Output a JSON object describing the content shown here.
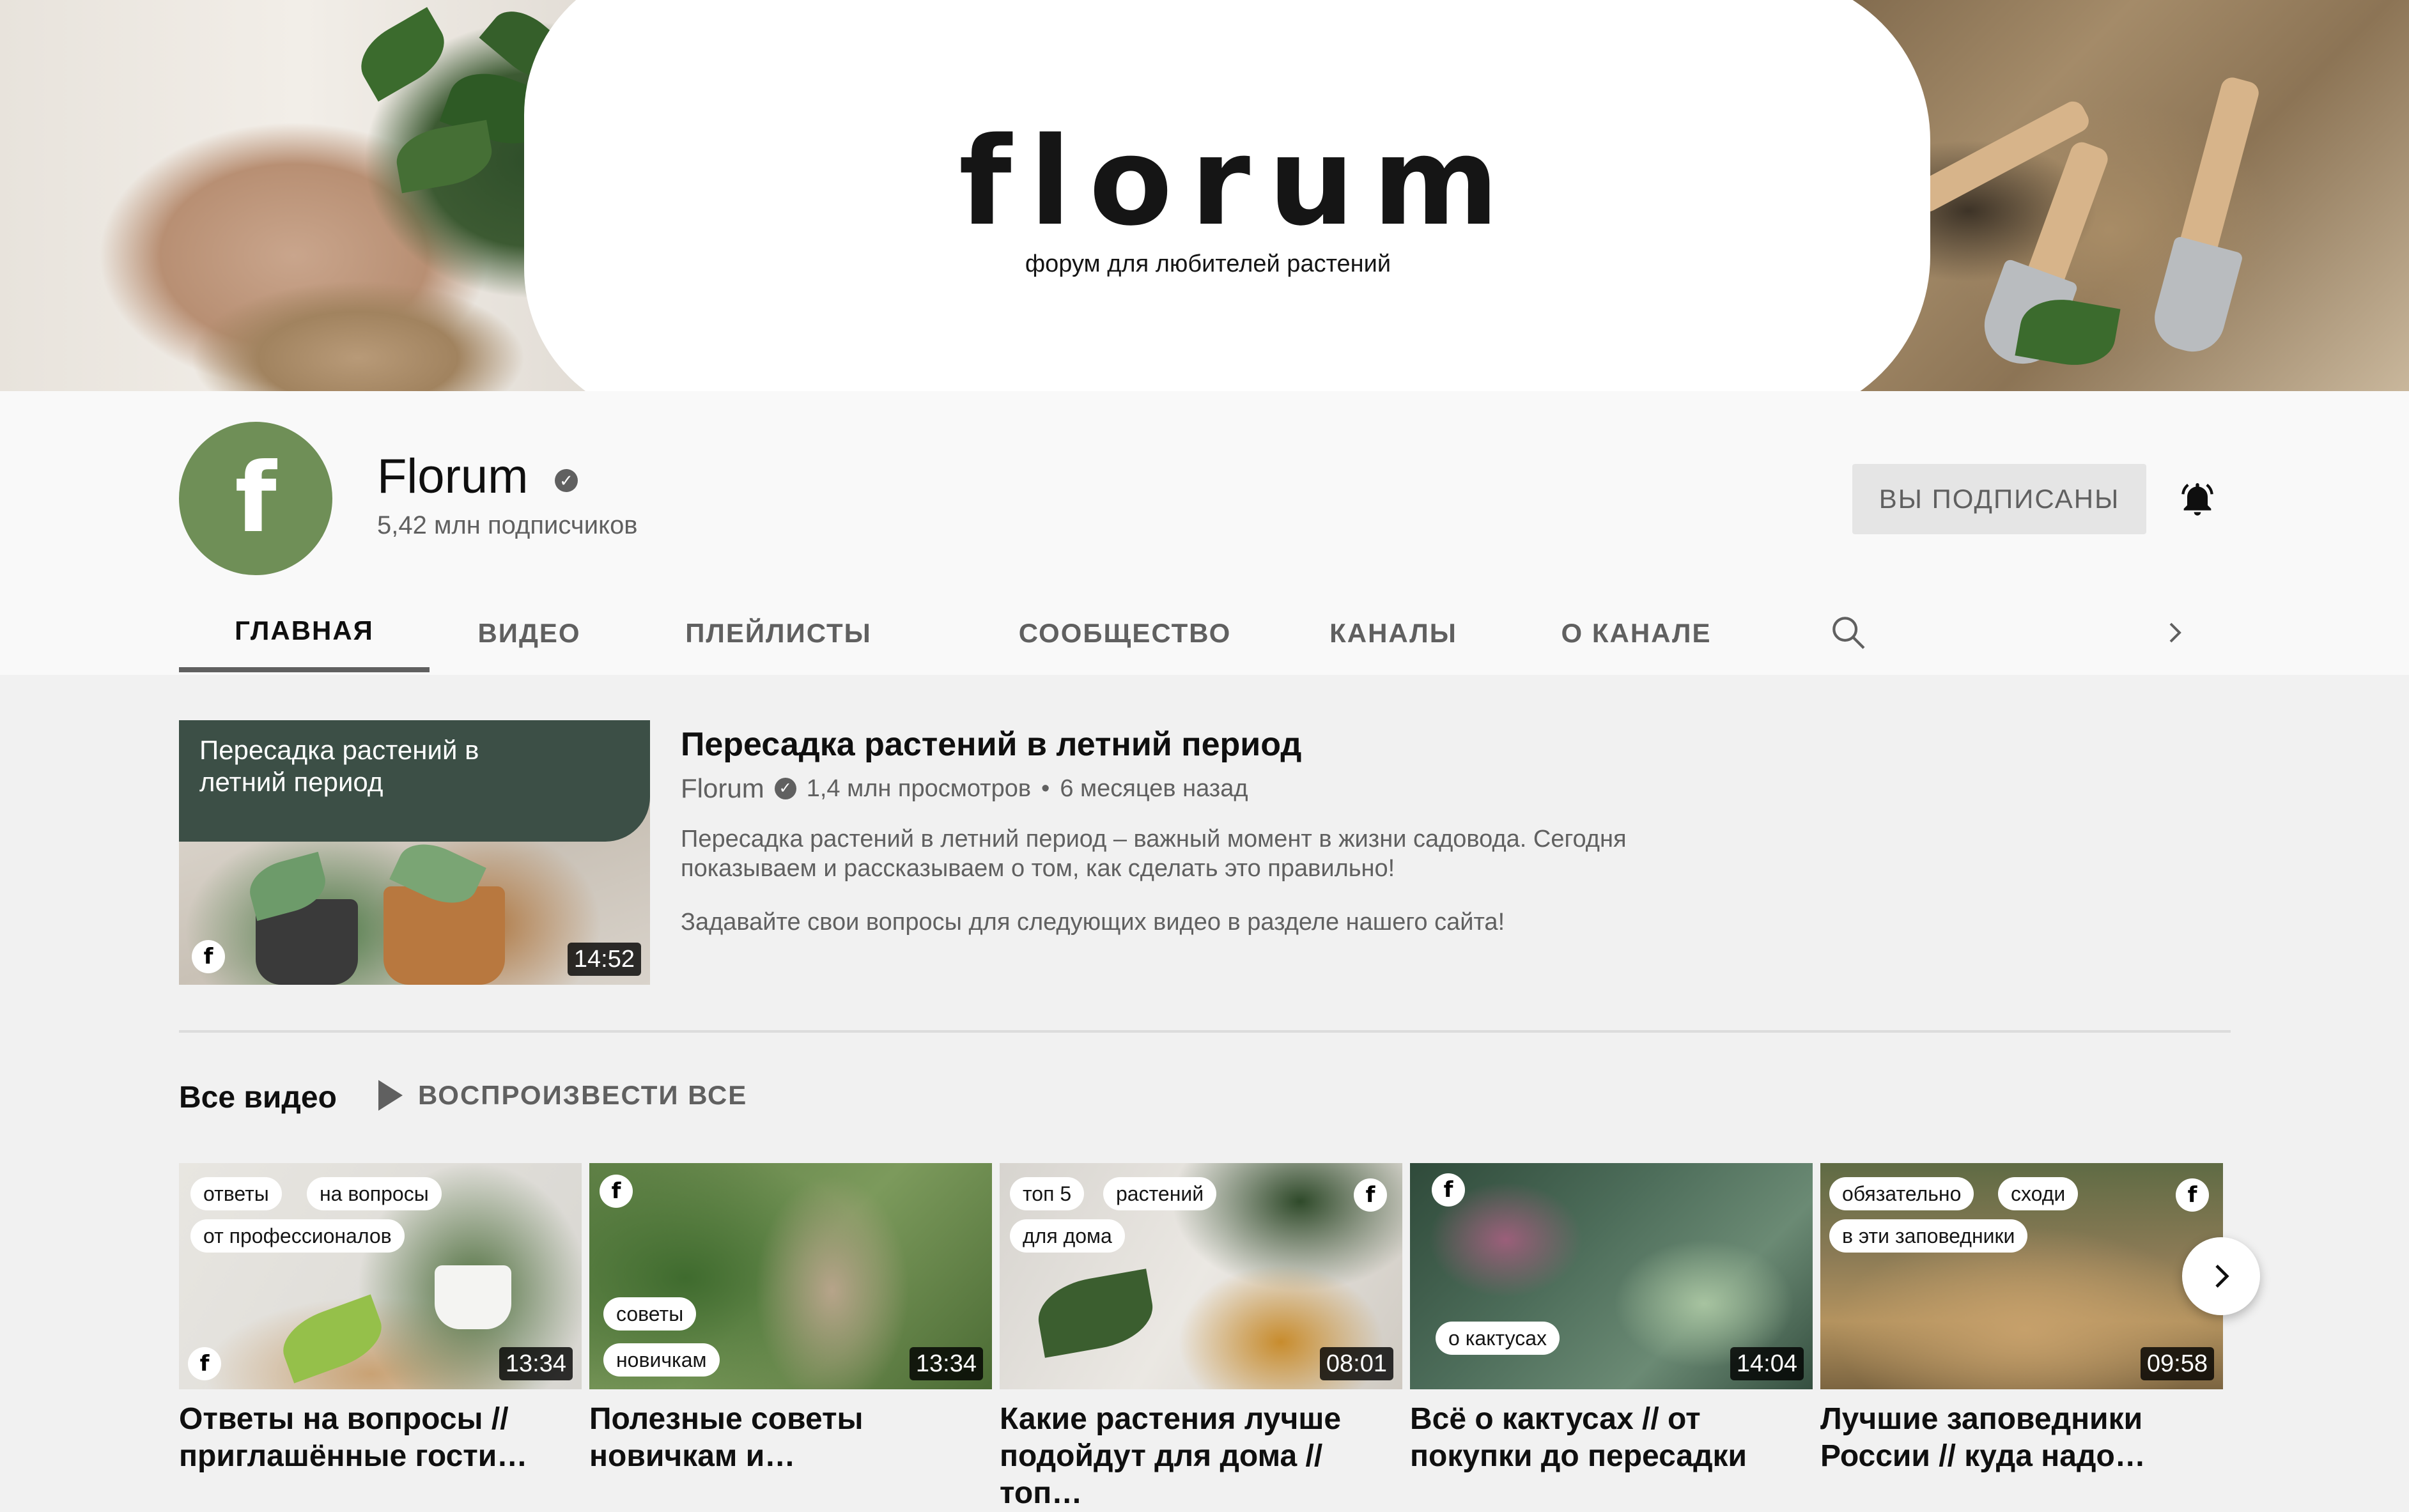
{
  "banner": {
    "brand": "florum",
    "tagline": "форум для любителей растений"
  },
  "channel": {
    "avatar_letter": "f",
    "name": "Florum",
    "subscribers": "5,42 млн подписчиков",
    "subscribe_label": "ВЫ ПОДПИСАНЫ",
    "avatar_color": "#6f8f57"
  },
  "tabs": [
    {
      "label": "ГЛАВНАЯ",
      "active": true
    },
    {
      "label": "ВИДЕО"
    },
    {
      "label": "ПЛЕЙЛИСТЫ"
    },
    {
      "label": "СООБЩЕСТВО"
    },
    {
      "label": "КАНАЛЫ"
    },
    {
      "label": "О КАНАЛЕ"
    }
  ],
  "featured": {
    "thumb_text": "Пересадка растений в летний период",
    "duration": "14:52",
    "title": "Пересадка растений в летний период",
    "channel": "Florum",
    "views": "1,4 млн просмотров",
    "age": "6 месяцев назад",
    "description_1": "Пересадка растений в летний период – важный момент в жизни садовода. Сегодня показываем и рассказываем о том, как сделать это правильно!",
    "description_2": "Задавайте свои вопросы для следующих видео в разделе нашего сайта!"
  },
  "all_videos": {
    "title": "Все видео",
    "play_all_label": "ВОСПРОИЗВЕСТИ ВСЕ",
    "videos": [
      {
        "chips": [
          "ответы",
          "на вопросы",
          "от профессионалов"
        ],
        "duration": "13:34",
        "title": "Ответы на вопросы // приглашённые гости…"
      },
      {
        "chips": [
          "советы",
          "новичкам"
        ],
        "duration": "13:34",
        "title": "Полезные советы новичкам и…"
      },
      {
        "chips": [
          "топ 5",
          "растений",
          "для дома"
        ],
        "duration": "08:01",
        "title": "Какие растения лучше подойдут для дома // топ…"
      },
      {
        "chips": [
          "о кактусах"
        ],
        "duration": "14:04",
        "title": "Всё о кактусах // от покупки до пересадки"
      },
      {
        "chips": [
          "обязательно",
          "сходи",
          "в эти заповедники"
        ],
        "duration": "09:58",
        "title": "Лучшие заповедники России // куда надо…"
      }
    ]
  },
  "colors": {
    "page_bg": "#f1f1f1",
    "header_bg": "#f9f9f9",
    "secondary_text": "#606060",
    "featured_banner": "#3c4f46"
  }
}
